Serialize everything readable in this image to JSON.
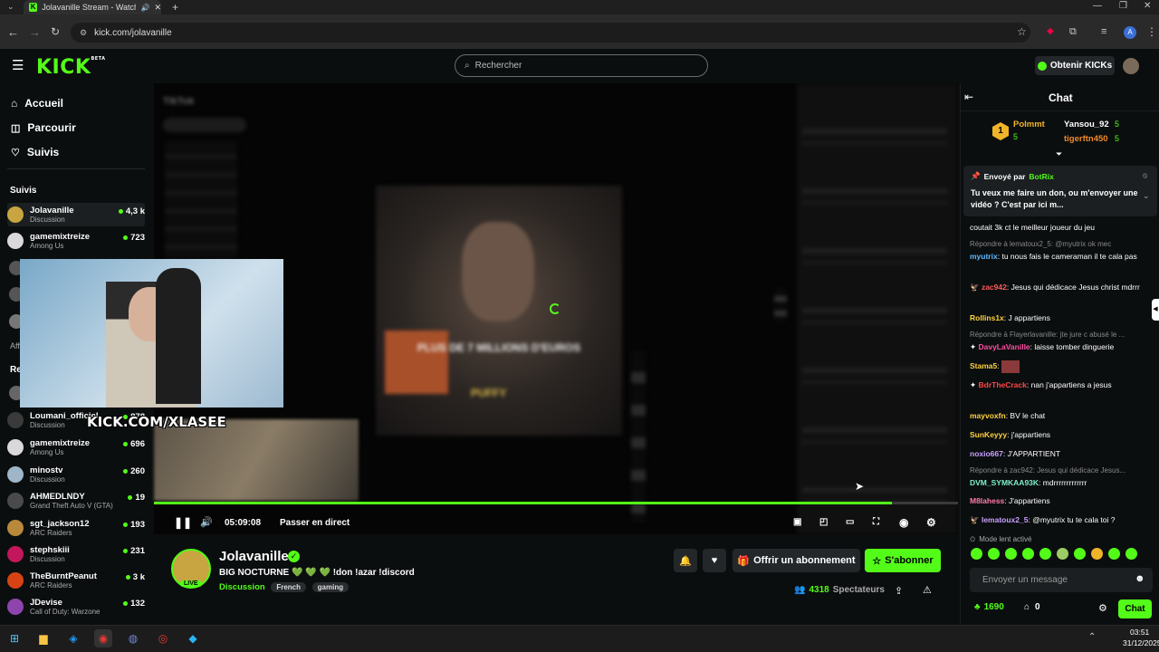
{
  "browser": {
    "tab_title": "Jolavanille Stream - Watch",
    "url": "kick.com/jolavanille",
    "profile_initial": "A"
  },
  "header": {
    "logo": "KICK",
    "logo_badge": "BETA",
    "search_placeholder": "Rechercher",
    "kicks_button": "Obtenir KICKs"
  },
  "sidebar": {
    "nav": [
      {
        "label": "Accueil",
        "icon": "home-icon"
      },
      {
        "label": "Parcourir",
        "icon": "compass-icon"
      },
      {
        "label": "Suivis",
        "icon": "heart-icon"
      }
    ],
    "section_followed": "Suivis",
    "followed": [
      {
        "name": "Jolavanille",
        "category": "Discussion",
        "viewers": "4,3 k"
      },
      {
        "name": "gamemixtreize",
        "category": "Among Us",
        "viewers": "723"
      }
    ],
    "section_recommended_partial": "Re",
    "section_aff_partial": "Aff",
    "recommended": [
      {
        "name": "Loumani_officiel",
        "category": "Discussion",
        "viewers": "878"
      },
      {
        "name": "gamemixtreize",
        "category": "Among Us",
        "viewers": "696"
      },
      {
        "name": "minostv",
        "category": "Discussion",
        "viewers": "260"
      },
      {
        "name": "AHMEDLNDY",
        "category": "Grand Theft Auto V (GTA)",
        "viewers": "19"
      },
      {
        "name": "sgt_jackson12",
        "category": "ARC Raiders",
        "viewers": "193"
      },
      {
        "name": "stephskiii",
        "category": "Discussion",
        "viewers": "231"
      },
      {
        "name": "TheBurntPeanut",
        "category": "ARC Raiders",
        "viewers": "3 k"
      },
      {
        "name": "JDevise",
        "category": "Call of Duty: Warzone",
        "viewers": "132"
      }
    ]
  },
  "video": {
    "overlay_text": "PLUS DE 7 MILLIONS D'EUROS",
    "overlay_text2": "PUFFY",
    "tiktok_label": "TikTok",
    "cam_label": "KICK.COM/XLASEE",
    "time": "05:09:08",
    "live_button": "Passer en direct",
    "progress": 0.918
  },
  "stream": {
    "channel": "Jolavanille",
    "title": "BIG NOCTURNE 💚 💚 💚 !don !azar !discord",
    "category": "Discussion",
    "tags": [
      "French",
      "gaming"
    ],
    "live_badge": "LIVE",
    "gift_button": "Offrir un abonnement",
    "subscribe_button": "S'abonner",
    "viewers": "4318",
    "viewers_label": "Spectateurs"
  },
  "chat": {
    "title": "Chat",
    "leaderboard": [
      {
        "rank": "1",
        "name": "Polmmt",
        "value": "5"
      },
      {
        "name": "Yansou_92",
        "value": "5"
      },
      {
        "name": "tigerftn450",
        "value": "5"
      }
    ],
    "pinned": {
      "header": "Envoyé par",
      "author": "BotRix",
      "text": "Tu veux me faire un don, ou m'envoyer une vidéo ? C'est par ici m..."
    },
    "messages": [
      {
        "type": "msg",
        "user": "",
        "text": "coutait 3k ct le meilleur joueur du jeu",
        "color": "#ffffff"
      },
      {
        "type": "reply",
        "text": "Répondre à lematoux2_5: @myutrix ok mec"
      },
      {
        "type": "msg",
        "user": "myutrix",
        "text": "tu nous fais le cameraman il te cala pas",
        "color": "#5bb8ff"
      },
      {
        "type": "msg",
        "user": "zac942",
        "text": "Jesus qui dédicace Jesus christ mdrrr",
        "color": "#ff5a5a"
      },
      {
        "type": "msg",
        "user": "Rollins1x",
        "text": "J appartiens",
        "color": "#ffd33d"
      },
      {
        "type": "reply",
        "text": "Répondre à Flayerlavanille: jte jure c abusé le ..."
      },
      {
        "type": "msg",
        "user": "DavyLaVanille",
        "text": "laisse tomber dinguerie",
        "color": "#ff4ea1"
      },
      {
        "type": "msg",
        "user": "Stama5",
        "text": "",
        "color": "#ffd33d"
      },
      {
        "type": "msg",
        "user": "BdrTheCrack",
        "text": "nan j'appartiens a jesus",
        "color": "#ff4646"
      },
      {
        "type": "msg",
        "user": "mayvoxfn",
        "text": "BV le chat",
        "color": "#ffd33d"
      },
      {
        "type": "msg",
        "user": "SunKeyyy",
        "text": "j'appartiens",
        "color": "#ffd33d"
      },
      {
        "type": "msg",
        "user": "noxio667",
        "text": "J'APPARTIENT",
        "color": "#c9a0ff"
      },
      {
        "type": "reply",
        "text": "Répondre à zac942: Jesus qui dédicace Jesus..."
      },
      {
        "type": "msg",
        "user": "DVM_SYMKAA93K",
        "text": "mdrrrrrrrrrrrrr",
        "color": "#7ef0c8"
      },
      {
        "type": "msg",
        "user": "M8lahess",
        "text": "J'appartiens",
        "color": "#ff7aa8"
      },
      {
        "type": "msg",
        "user": "lematoux2_5",
        "text": "@myutrix tu te cala toi ?",
        "color": "#c9a0ff"
      }
    ],
    "slow_mode": "Mode lent activé",
    "input_placeholder": "Envoyer un message",
    "points": "1690",
    "gifts": "0",
    "send_button": "Chat"
  },
  "taskbar": {
    "time": "03:51",
    "date": "31/12/2025"
  }
}
